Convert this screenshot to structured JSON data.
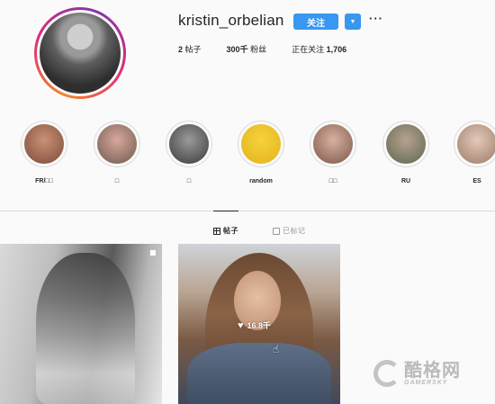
{
  "profile": {
    "username": "kristin_orbelian",
    "follow_label": "关注",
    "dropdown_icon": "chevron-down-icon",
    "more_label": "···"
  },
  "stats": {
    "posts_count": "2",
    "posts_label": "帖子",
    "followers_count": "300千",
    "followers_label": "粉丝",
    "following_label": "正在关注",
    "following_count": "1,706"
  },
  "highlights": [
    {
      "label": "FR/□□",
      "colors": [
        "#c99075",
        "#7b4b3a"
      ]
    },
    {
      "label": "□",
      "colors": [
        "#d9a79b",
        "#6d5a4f"
      ]
    },
    {
      "label": "□",
      "colors": [
        "#9a9a9a",
        "#3a3a3a"
      ]
    },
    {
      "label": "random",
      "colors": [
        "#f5d33b",
        "#e3b21c"
      ]
    },
    {
      "label": "□□",
      "colors": [
        "#d8b1a0",
        "#7a5546"
      ]
    },
    {
      "label": "RU",
      "colors": [
        "#b8a18f",
        "#5a6850"
      ]
    },
    {
      "label": "ES",
      "colors": [
        "#e4c9b9",
        "#9b7a68"
      ]
    }
  ],
  "tabs": {
    "posts_label": "帖子",
    "tagged_label": "已标记"
  },
  "post_overlay": {
    "likes": "16.8千"
  },
  "watermark": {
    "cn": "酷格网",
    "en": "GAMERSKY"
  },
  "colors": {
    "accent": "#3897f0",
    "text": "#262626",
    "muted": "#999999",
    "border": "#dbdbdb"
  }
}
